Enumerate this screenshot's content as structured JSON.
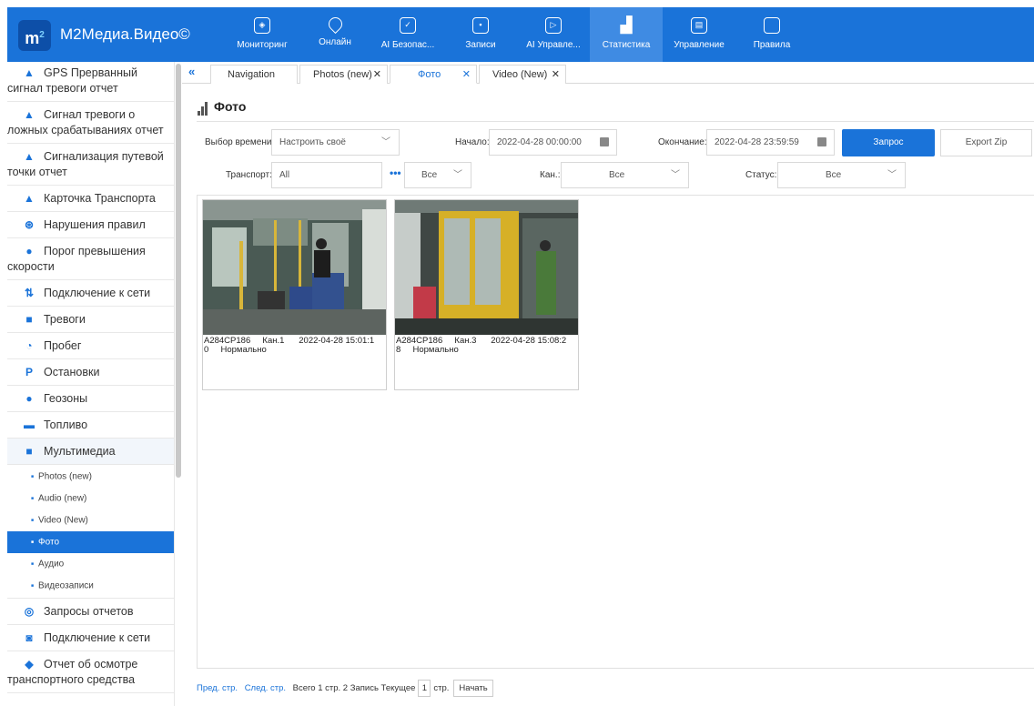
{
  "app": {
    "brand": "M2Медиа.Видео©",
    "logo_text": "m",
    "logo_sup": "2"
  },
  "nav": [
    {
      "label": "Мониторинг",
      "icon": "shield-icon"
    },
    {
      "label": "Онлайн",
      "icon": "location-pin-icon"
    },
    {
      "label": "AI Безопас...",
      "icon": "shield-check-icon"
    },
    {
      "label": "Записи",
      "icon": "record-icon"
    },
    {
      "label": "AI Управле...",
      "icon": "play-shield-icon"
    },
    {
      "label": "Статистика",
      "icon": "bar-chart-icon",
      "active": true
    },
    {
      "label": "Управление",
      "icon": "management-icon"
    },
    {
      "label": "Правила",
      "icon": "rules-icon"
    }
  ],
  "sidebar": {
    "items": [
      {
        "label": "GPS Прерванный сигнал тревоги отчет",
        "icon": "warning-icon"
      },
      {
        "label": "Сигнал тревоги о ложных срабатываниях отчет",
        "icon": "warning-icon"
      },
      {
        "label": "Сигнализация путевой точки отчет",
        "icon": "warning-icon"
      },
      {
        "label": "Карточка Транспорта",
        "icon": "warning-icon"
      },
      {
        "label": "Нарушения правил",
        "icon": "steering-wheel-icon"
      },
      {
        "label": "Порог превышения скорости",
        "icon": "speedometer-icon"
      },
      {
        "label": "Подключение к сети",
        "icon": "network-icon"
      },
      {
        "label": "Тревоги",
        "icon": "alarm-icon"
      },
      {
        "label": "Пробег",
        "icon": "mileage-icon"
      },
      {
        "label": "Остановки",
        "icon": "parking-icon"
      },
      {
        "label": "Геозоны",
        "icon": "geofence-icon"
      },
      {
        "label": "Топливо",
        "icon": "fuel-icon"
      },
      {
        "label": "Мультимедиа",
        "icon": "multimedia-icon"
      }
    ],
    "sub_items": [
      {
        "label": "Photos (new)"
      },
      {
        "label": "Audio (new)"
      },
      {
        "label": "Video (New)"
      },
      {
        "label": "Фото",
        "active": true
      },
      {
        "label": "Аудио"
      },
      {
        "label": "Видеозаписи"
      }
    ],
    "items_after": [
      {
        "label": "Запросы отчетов",
        "icon": "report-query-icon"
      },
      {
        "label": "Подключение к сети",
        "icon": "network-search-icon"
      },
      {
        "label": "Отчет об осмотре транспортного средства",
        "icon": "inspection-icon"
      }
    ]
  },
  "tabs": {
    "collapse": "«",
    "items": [
      {
        "label": "Navigation",
        "closable": false
      },
      {
        "label": "Photos (new)",
        "closable": true
      },
      {
        "label": "Фото",
        "closable": true,
        "active": true
      },
      {
        "label": "Video (New)",
        "closable": true
      }
    ],
    "close_glyph": "✕"
  },
  "page": {
    "title": "Фото"
  },
  "filters": {
    "time_label": "Выбор времени:",
    "time_value": "Настроить своё",
    "start_label": "Начало:",
    "start_value": "2022-04-28 00:00:00",
    "end_label": "Окончание:",
    "end_value": "2022-04-28 23:59:59",
    "query_button": "Запрос",
    "export_button": "Export Zip",
    "vehicle_label": "Транспорт:",
    "vehicle_value": "All",
    "vehicle_more": "•••",
    "vehicle_select": "Все",
    "channel_label": "Кан.:",
    "channel_value": "Все",
    "status_label": "Статус:",
    "status_value": "Все"
  },
  "photos": [
    {
      "caption": "A284CP186     Кан.1      2022-04-28 15:01:1\n0     Нормально"
    },
    {
      "caption": "A284CP186     Кан.3      2022-04-28 15:08:2\n8     Нормально"
    }
  ],
  "pager": {
    "prev": "Пред. стр.",
    "next": "След. стр.",
    "total_pages": "Всего 1 стр.",
    "total_records": "2 Запись",
    "current_label": "Текущее",
    "current": "1",
    "page_suffix": "стр.",
    "go": "Начать"
  },
  "colors": {
    "accent": "#1a73d9",
    "nav_active": "#3f8be3"
  }
}
